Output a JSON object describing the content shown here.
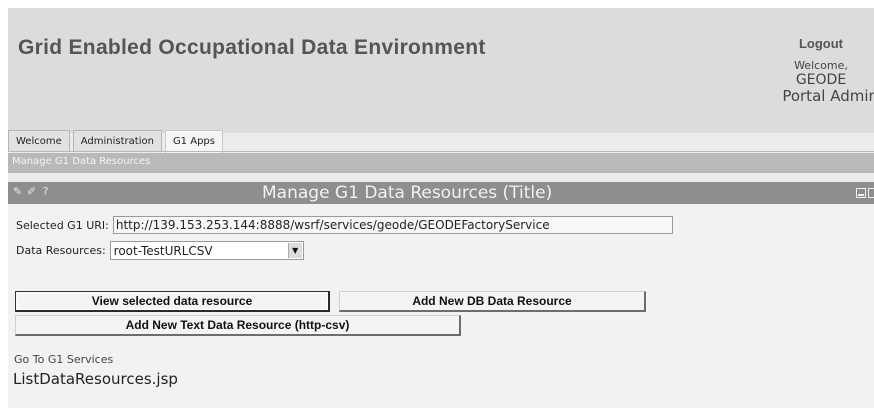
{
  "header": {
    "site_title": "Grid Enabled Occupational Data Environment",
    "logout_label": "Logout",
    "welcome_text": "Welcome,",
    "user_name": "GEODE",
    "user_role": "Portal Admin"
  },
  "tabs": [
    {
      "label": "Welcome",
      "active": false
    },
    {
      "label": "Administration",
      "active": false
    },
    {
      "label": "G1 Apps",
      "active": true
    }
  ],
  "breadcrumb": "Manage G1 Data Resources",
  "portlet": {
    "title": "Manage G1 Data Resources (Title)",
    "tools": {
      "edit": "✎",
      "pencil": "✐",
      "help": "?"
    }
  },
  "form": {
    "uri_label": "Selected G1 URI:",
    "uri_value": "http://139.153.253.144:8888/wsrf/services/geode/GEODEFactoryService",
    "resources_label": "Data Resources:",
    "resources_selected": "root-TestURLCSV"
  },
  "buttons": {
    "view_selected": "View selected data resource",
    "add_db": "Add New DB Data Resource",
    "add_text": "Add New Text Data Resource (http-csv)"
  },
  "links": {
    "goto_services": "Go To G1 Services"
  },
  "footer_text": "ListDataResources.jsp",
  "colors": {
    "header_bg": "#dcdcdc",
    "breadcrumb_bg": "#b9b9b9",
    "portlet_bar_bg": "#8e8e8e",
    "content_bg": "#f2f2f2"
  }
}
